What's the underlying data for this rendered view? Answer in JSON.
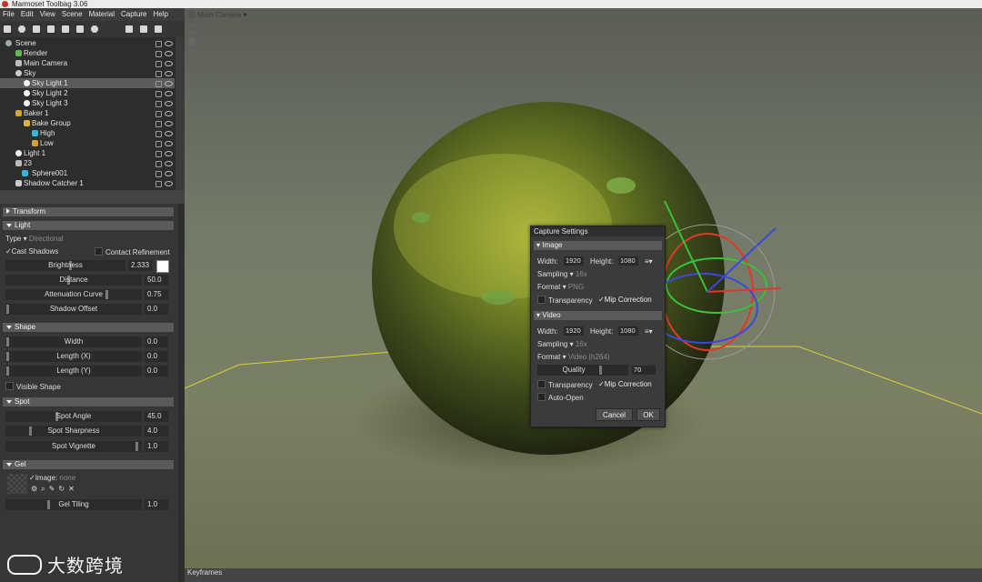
{
  "window": {
    "title": "Marmoset Toolbag 3.06"
  },
  "menu": [
    "File",
    "Edit",
    "View",
    "Scene",
    "Material",
    "Capture",
    "Help"
  ],
  "viewport_label": "Main Camera",
  "outliner": [
    {
      "label": "Scene",
      "indent": 0,
      "icon_color": "#9aa",
      "selected": false
    },
    {
      "label": "Render",
      "indent": 1,
      "icon_color": "#5dbb4b",
      "selected": false
    },
    {
      "label": "Main Camera",
      "indent": 1,
      "icon_color": "#bbbbbb",
      "selected": false
    },
    {
      "label": "Sky",
      "indent": 1,
      "icon_color": "#cccccc",
      "selected": false
    },
    {
      "label": "Sky Light 1",
      "indent": 2,
      "icon_color": "#f2f2f2",
      "selected": true
    },
    {
      "label": "Sky Light 2",
      "indent": 2,
      "icon_color": "#f2f2f2",
      "selected": false
    },
    {
      "label": "Sky Light 3",
      "indent": 2,
      "icon_color": "#f2f2f2",
      "selected": false
    },
    {
      "label": "Baker 1",
      "indent": 1,
      "icon_color": "#d9a13a",
      "selected": false
    },
    {
      "label": "Bake Group",
      "indent": 2,
      "icon_color": "#e0b040",
      "selected": false
    },
    {
      "label": "High",
      "indent": 3,
      "icon_color": "#3ab3d8",
      "selected": false
    },
    {
      "label": "Low",
      "indent": 3,
      "icon_color": "#d8a030",
      "selected": false
    },
    {
      "label": "Light 1",
      "indent": 1,
      "icon_color": "#f2f2f2",
      "selected": false
    },
    {
      "label": "23",
      "indent": 1,
      "icon_color": "#bbbbbb",
      "selected": false
    },
    {
      "label": "Sphere001",
      "indent": 1,
      "icon_color": "#3ab3d8",
      "selected": false
    },
    {
      "label": "Shadow Catcher 1",
      "indent": 1,
      "icon_color": "#cccccc",
      "selected": false
    }
  ],
  "props": {
    "transform": "Transform",
    "light": "Light",
    "type_label": "Type",
    "type_value": "Directional",
    "cast_shadows": "Cast Shadows",
    "contact_refinement": "Contact Refinement",
    "brightness": {
      "label": "Brightness",
      "value": "2.333"
    },
    "distance": {
      "label": "Distance",
      "value": "50.0"
    },
    "attenuation": {
      "label": "Attenuation Curve",
      "value": "0.75"
    },
    "shadow_offset": {
      "label": "Shadow Offset",
      "value": "0.0"
    },
    "shape": "Shape",
    "width": {
      "label": "Width",
      "value": "0.0"
    },
    "length_x": {
      "label": "Length (X)",
      "value": "0.0"
    },
    "length_y": {
      "label": "Length (Y)",
      "value": "0.0"
    },
    "visible_shape": "Visible Shape",
    "spot": "Spot",
    "spot_angle": {
      "label": "Spot Angle",
      "value": "45.0"
    },
    "spot_sharpness": {
      "label": "Spot Sharpness",
      "value": "4.0"
    },
    "spot_vignette": {
      "label": "Spot Vignette",
      "value": "1.0"
    },
    "gel": "Gel",
    "gel_image_label": "Image:",
    "gel_image_value": "none",
    "gel_tiling": {
      "label": "Gel Tiling",
      "value": "1.0"
    }
  },
  "capture": {
    "title": "Capture Settings",
    "image_section": "Image",
    "width_label": "Width:",
    "height_label": "Height:",
    "image_width": "1920",
    "image_height": "1080",
    "sampling_label": "Sampling",
    "image_sampling": "16x",
    "format_label": "Format",
    "image_format": "PNG",
    "transparency": "Transparency",
    "mip_correction": "Mip Correction",
    "video_section": "Video",
    "video_width": "1920",
    "video_height": "1080",
    "video_sampling": "16x",
    "video_format": "Video (h264)",
    "quality_label": "Quality",
    "quality_value": "70",
    "auto_open": "Auto-Open",
    "cancel": "Cancel",
    "ok": "OK"
  },
  "keyframes": "Keyframes",
  "watermark": "大数跨境"
}
